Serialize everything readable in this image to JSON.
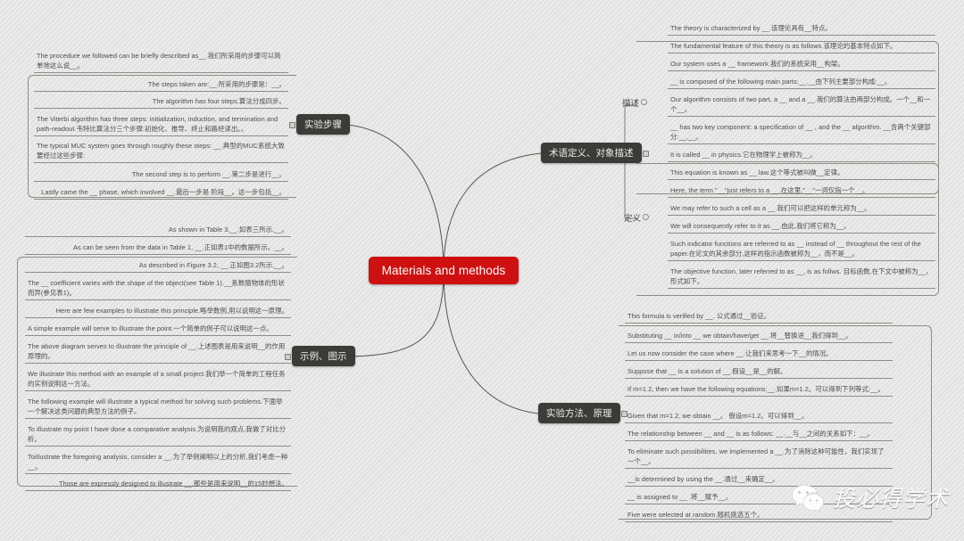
{
  "mindmap": {
    "root": {
      "label": "Materials and methods",
      "color": "#cf1010"
    },
    "branches": [
      {
        "id": "experiment-steps",
        "label": "实验步骤",
        "side": "left",
        "items": [
          "The procedure we followed can be briefly described as__.我们所采用的步骤可以简单地这么说__。",
          "The steps taken are:__.所采用的步骤是：__。",
          "The algorithm has four steps.算法分成四步。",
          "The Viterbi algorithm has three steps: initialization, induction, and termination and path-readout.韦特比算法分三个步骤:初始化、推导、终止和路经读出。。",
          "The typical MUC system goes through roughly these steps: __.典型的MUC系统大致要经过这些步骤:",
          "The second step is to perform __.第二步是进行__。",
          "Lastly came the __ phase, which involved __.最后一步是 阶段__。这一步包括__。"
        ]
      },
      {
        "id": "examples-illustrations",
        "label": "示例、图示",
        "side": "left",
        "items": [
          "As shown in Table 3,__.如表三所示,__。",
          "As can be seen from the data in Table 1, __.正如表1中的数据所示。__。",
          "As described in Figure 3.2, __.正如图3.2所示,__。",
          "The __ coefficient varies with the shape of the object(see Table 1).__系数随物体的形状而异(参见表1)。",
          "Here are few examples to illustrate this principle.略举数例,用以说明这一原理。",
          "A simple example will serve to illustrate the point.一个简单的例子可以说明这一点。",
          "The above diagram serves to illustrate the principle of __.上述图表是用来说明__的作用原理的。",
          "We illustrate this method with an example of a small project.我们举一个简单的工程任务的实例说明这一方法。",
          "The following example will illustrate a typical method for solving such problems.下面举一个解决这类问题的典型方法的例子。",
          "To illustrate my point I have done a comparative analysis.为说明我的观点,我做了对比分析。",
          "ToiIlustrate the foregoing analysis, consider a __.为了举例阐明以上的分析,我们考虑一种__。",
          "Those are expressly designed to illustrate __.那些是用来说明__的15妙想法。"
        ]
      },
      {
        "id": "terminology-definition",
        "label": "术语定义、对象描述",
        "side": "right",
        "subgroups": [
          {
            "id": "description",
            "label": "描述",
            "items": [
              "The theory is characterized by __.该理论具有__特点。",
              "The fundamental feature of this theory is as follows.该理论的基本特点如下。",
              "Our system uses a __ framework.我们的系统采用__构架。",
              "__ is composed of the following main parts:__.__由下列主要部分构成:__。",
              "Our algorithm consists of two part, a __ and a __.我们的算法由两部分构成。一个__和一个__。",
              "__ has two key component: a specification of __ , and the __ algorithm. __含两个关键部分:__,__。"
            ]
          },
          {
            "id": "definition",
            "label": "定义",
            "items": [
              "It is called __ in physics.它在物理学上被称为__。",
              "This equation is known as __ law.这个等式被叫做__定律。",
              "Here, the term \"__\"just refers to a __.在这里,\"__\"一词仅指一个__。",
              "We may refer to such a cell as a __.我们可以把这样的单元称为__。",
              "We will consequently refer to it as __.由此,我们将它称为__。",
              "Such indicator functions are referred to as __ instead of __ throughout the rest of the paper.在论文的其余部分,这样的指示函数被称为__，而不是__。",
              "The objective function, later referred to as __, is as follws. 目标函数,在下文中被称为__，形式如下。"
            ]
          }
        ]
      },
      {
        "id": "experiment-methods",
        "label": "实验方法、原理",
        "side": "right",
        "items": [
          "This formula is verified by __. 公式通过__验证。",
          "Substituting __ in/into __ we obtain/have/get __.将__替换进__我们得到__。",
          "Let us now consider the case where __.让我们来思考一下__的情况。",
          "Suppose that __ is a solution of __.假设__是__的解。",
          "If m=1.2, then we have the following equations:__.如果m=1.2。可以得到下列等式:__。",
          "Given that m=1.2, we obtain __。 假设m=1.2。可以得到__。",
          "The relationship between __ and __ is as follows: __.__与__之间的关系如下：__。",
          "To eliminate such possibilities, we implemented a __.为了消除这种可能性，我们实现了一个__。",
          "__is determined by using the __.通过__来确定__。",
          "__ is assigned to __ .将__赋予__。",
          "Five were selected at random.随机挑选五个。"
        ]
      }
    ]
  },
  "watermark": {
    "text": "投必得学术",
    "icon": "wechat-icon"
  }
}
